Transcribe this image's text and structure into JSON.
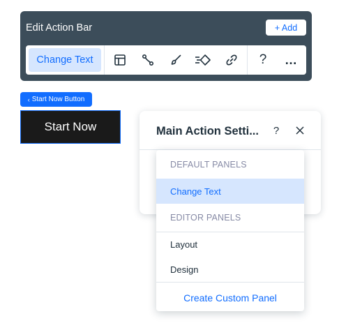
{
  "action_bar": {
    "title": "Edit Action Bar",
    "add_label": "+ Add",
    "change_text_label": "Change Text",
    "icons": [
      "layout-icon",
      "connect-icon",
      "design-brush-icon",
      "animation-icon",
      "link-icon",
      "help-icon",
      "more-icon"
    ],
    "help_glyph": "?",
    "more_glyph": "…"
  },
  "element": {
    "tag_label": "Start Now Button",
    "button_label": "Start Now"
  },
  "panel": {
    "title": "Main Action Setti...",
    "help_glyph": "?"
  },
  "dropdown": {
    "section_default": "DEFAULT PANELS",
    "default_items": [
      "Change Text"
    ],
    "section_editor": "EDITOR PANELS",
    "editor_items": [
      "Layout",
      "Design"
    ],
    "create_label": "Create Custom Panel"
  },
  "colors": {
    "accent": "#116dff",
    "action_bar_bg": "#3c4d5a",
    "selected_bg": "#d6e6fe",
    "button_bg": "#1a1a1a"
  }
}
